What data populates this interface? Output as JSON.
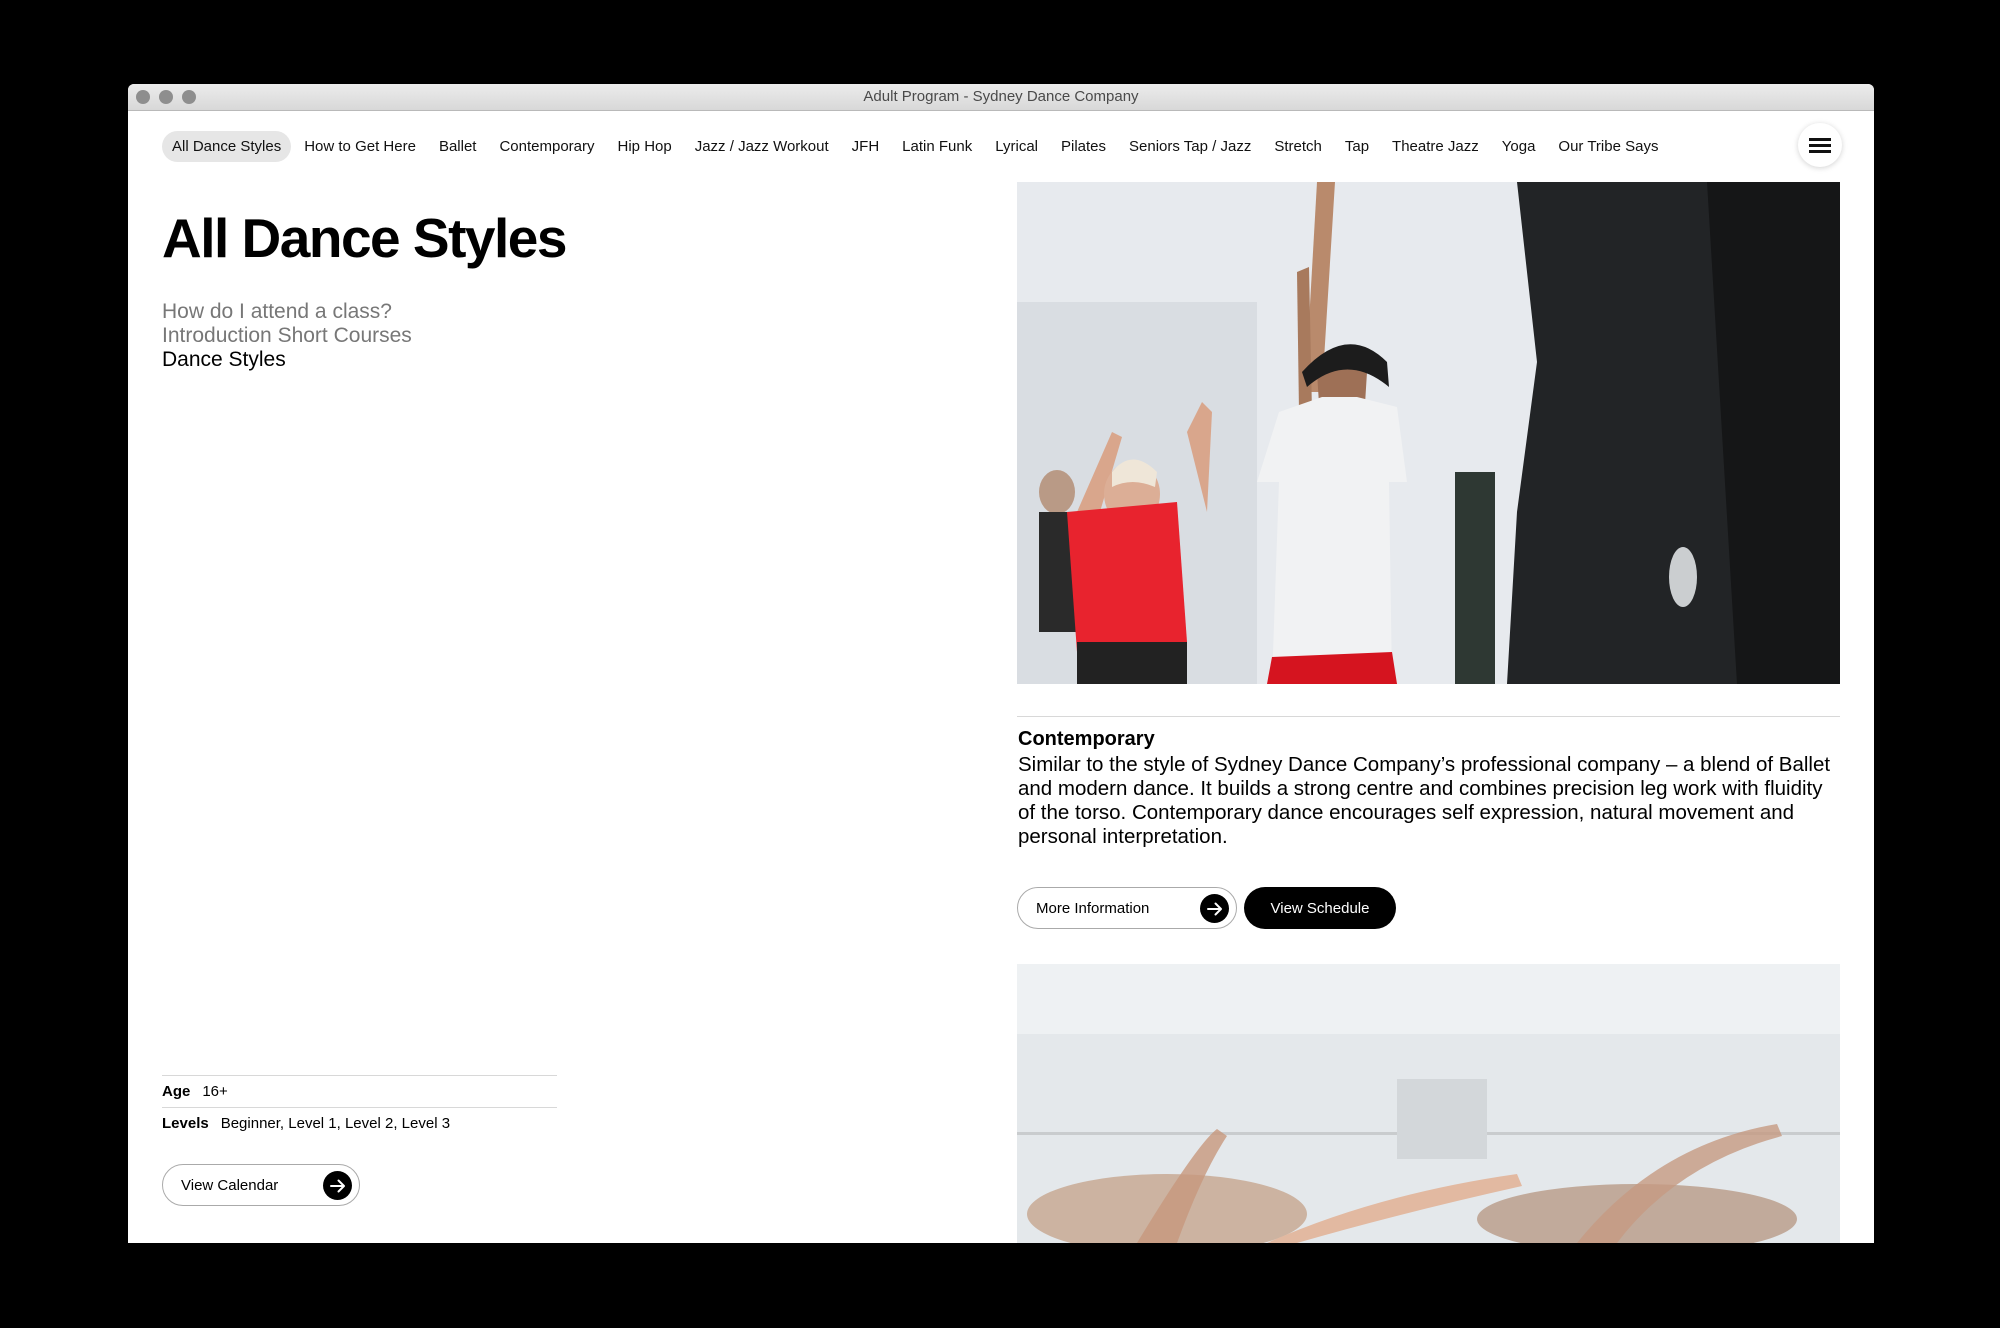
{
  "window": {
    "title": "Adult Program - Sydney Dance Company"
  },
  "nav": {
    "items": [
      {
        "label": "All Dance Styles",
        "active": true
      },
      {
        "label": "How to Get Here"
      },
      {
        "label": "Ballet"
      },
      {
        "label": "Contemporary"
      },
      {
        "label": "Hip Hop"
      },
      {
        "label": "Jazz / Jazz Workout"
      },
      {
        "label": "JFH"
      },
      {
        "label": "Latin Funk"
      },
      {
        "label": "Lyrical"
      },
      {
        "label": "Pilates"
      },
      {
        "label": "Seniors Tap / Jazz"
      },
      {
        "label": "Stretch"
      },
      {
        "label": "Tap"
      },
      {
        "label": "Theatre Jazz"
      },
      {
        "label": "Yoga"
      },
      {
        "label": "Our Tribe Says"
      }
    ],
    "menu_icon": "hamburger-icon"
  },
  "page": {
    "title": "All Dance Styles",
    "subnav": [
      {
        "label": "How do I attend a class?"
      },
      {
        "label": "Introduction Short Courses"
      },
      {
        "label": "Dance Styles",
        "current": true
      }
    ]
  },
  "meta": {
    "age_label": "Age",
    "age_value": "16+",
    "levels_label": "Levels",
    "levels_value": "Beginner, Level 1, Level 2, Level 3"
  },
  "buttons": {
    "view_calendar": "View Calendar",
    "more_information": "More Information",
    "view_schedule": "View Schedule",
    "arrow_icon": "arrow-right-icon"
  },
  "style": {
    "name": "Contemporary",
    "description": "Similar to the style of Sydney Dance Company’s professional company – a blend of Ballet and modern dance. It builds a strong centre and combines precision leg work with fluidity of the torso. Contemporary dance encourages self expression, natural movement and personal interpretation."
  },
  "colors": {
    "accent": "#000000",
    "active_tab_bg": "#e6e6e6",
    "muted_text": "#777777",
    "shirt_red": "#e8232e"
  }
}
